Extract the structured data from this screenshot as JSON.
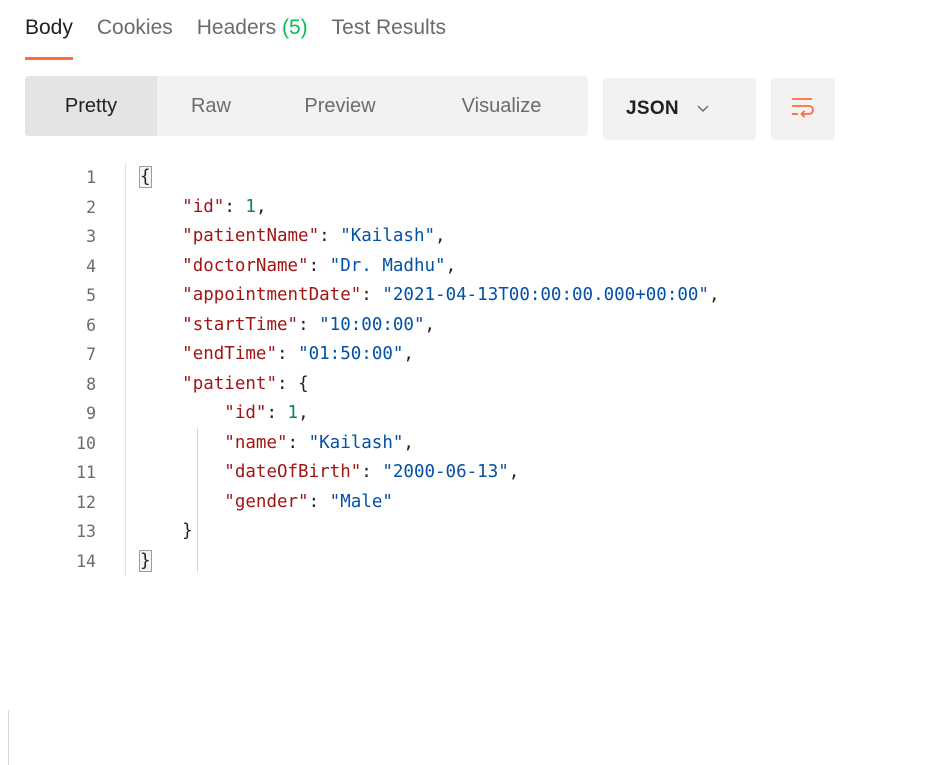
{
  "tabs": [
    {
      "label": "Body",
      "active": true
    },
    {
      "label": "Cookies",
      "active": false
    },
    {
      "label": "Headers",
      "count": "(5)",
      "active": false
    },
    {
      "label": "Test Results",
      "active": false
    }
  ],
  "view_modes": [
    {
      "label": "Pretty",
      "active": true
    },
    {
      "label": "Raw",
      "active": false
    },
    {
      "label": "Preview",
      "active": false
    },
    {
      "label": "Visualize",
      "active": false
    }
  ],
  "format_select": {
    "value": "JSON",
    "icon": "chevron-down-icon"
  },
  "wrap_button": {
    "icon": "wrap-lines-icon"
  },
  "colors": {
    "accent": "#ff6c37",
    "count": "#0cbb52",
    "key": "#a31515",
    "string": "#0451a5",
    "number": "#098658"
  },
  "lines": [
    {
      "n": "1",
      "tokens": [
        {
          "t": "{",
          "c": "brace hl"
        }
      ]
    },
    {
      "n": "2",
      "tokens": [
        {
          "t": "    ",
          "c": "punc"
        },
        {
          "t": "\"id\"",
          "c": "key"
        },
        {
          "t": ": ",
          "c": "punc"
        },
        {
          "t": "1",
          "c": "num"
        },
        {
          "t": ",",
          "c": "punc"
        }
      ]
    },
    {
      "n": "3",
      "tokens": [
        {
          "t": "    ",
          "c": "punc"
        },
        {
          "t": "\"patientName\"",
          "c": "key"
        },
        {
          "t": ": ",
          "c": "punc"
        },
        {
          "t": "\"Kailash\"",
          "c": "str"
        },
        {
          "t": ",",
          "c": "punc"
        }
      ]
    },
    {
      "n": "4",
      "tokens": [
        {
          "t": "    ",
          "c": "punc"
        },
        {
          "t": "\"doctorName\"",
          "c": "key"
        },
        {
          "t": ": ",
          "c": "punc"
        },
        {
          "t": "\"Dr. Madhu\"",
          "c": "str"
        },
        {
          "t": ",",
          "c": "punc"
        }
      ]
    },
    {
      "n": "5",
      "tokens": [
        {
          "t": "    ",
          "c": "punc"
        },
        {
          "t": "\"appointmentDate\"",
          "c": "key"
        },
        {
          "t": ": ",
          "c": "punc"
        },
        {
          "t": "\"2021-04-13T00:00:00.000+00:00\"",
          "c": "str"
        },
        {
          "t": ",",
          "c": "punc"
        }
      ]
    },
    {
      "n": "6",
      "tokens": [
        {
          "t": "    ",
          "c": "punc"
        },
        {
          "t": "\"startTime\"",
          "c": "key"
        },
        {
          "t": ": ",
          "c": "punc"
        },
        {
          "t": "\"10:00:00\"",
          "c": "str"
        },
        {
          "t": ",",
          "c": "punc"
        }
      ]
    },
    {
      "n": "7",
      "tokens": [
        {
          "t": "    ",
          "c": "punc"
        },
        {
          "t": "\"endTime\"",
          "c": "key"
        },
        {
          "t": ": ",
          "c": "punc"
        },
        {
          "t": "\"01:50:00\"",
          "c": "str"
        },
        {
          "t": ",",
          "c": "punc"
        }
      ]
    },
    {
      "n": "8",
      "tokens": [
        {
          "t": "    ",
          "c": "punc"
        },
        {
          "t": "\"patient\"",
          "c": "key"
        },
        {
          "t": ": ",
          "c": "punc"
        },
        {
          "t": "{",
          "c": "brace"
        }
      ]
    },
    {
      "n": "9",
      "tokens": [
        {
          "t": "        ",
          "c": "punc"
        },
        {
          "t": "\"id\"",
          "c": "key"
        },
        {
          "t": ": ",
          "c": "punc"
        },
        {
          "t": "1",
          "c": "num"
        },
        {
          "t": ",",
          "c": "punc"
        }
      ]
    },
    {
      "n": "10",
      "tokens": [
        {
          "t": "        ",
          "c": "punc"
        },
        {
          "t": "\"name\"",
          "c": "key"
        },
        {
          "t": ": ",
          "c": "punc"
        },
        {
          "t": "\"Kailash\"",
          "c": "str"
        },
        {
          "t": ",",
          "c": "punc"
        }
      ]
    },
    {
      "n": "11",
      "tokens": [
        {
          "t": "        ",
          "c": "punc"
        },
        {
          "t": "\"dateOfBirth\"",
          "c": "key"
        },
        {
          "t": ": ",
          "c": "punc"
        },
        {
          "t": "\"2000-06-13\"",
          "c": "str"
        },
        {
          "t": ",",
          "c": "punc"
        }
      ]
    },
    {
      "n": "12",
      "tokens": [
        {
          "t": "        ",
          "c": "punc"
        },
        {
          "t": "\"gender\"",
          "c": "key"
        },
        {
          "t": ": ",
          "c": "punc"
        },
        {
          "t": "\"Male\"",
          "c": "str"
        }
      ]
    },
    {
      "n": "13",
      "tokens": [
        {
          "t": "    ",
          "c": "punc"
        },
        {
          "t": "}",
          "c": "brace"
        }
      ]
    },
    {
      "n": "14",
      "tokens": [
        {
          "t": "}",
          "c": "brace hl"
        }
      ]
    }
  ]
}
